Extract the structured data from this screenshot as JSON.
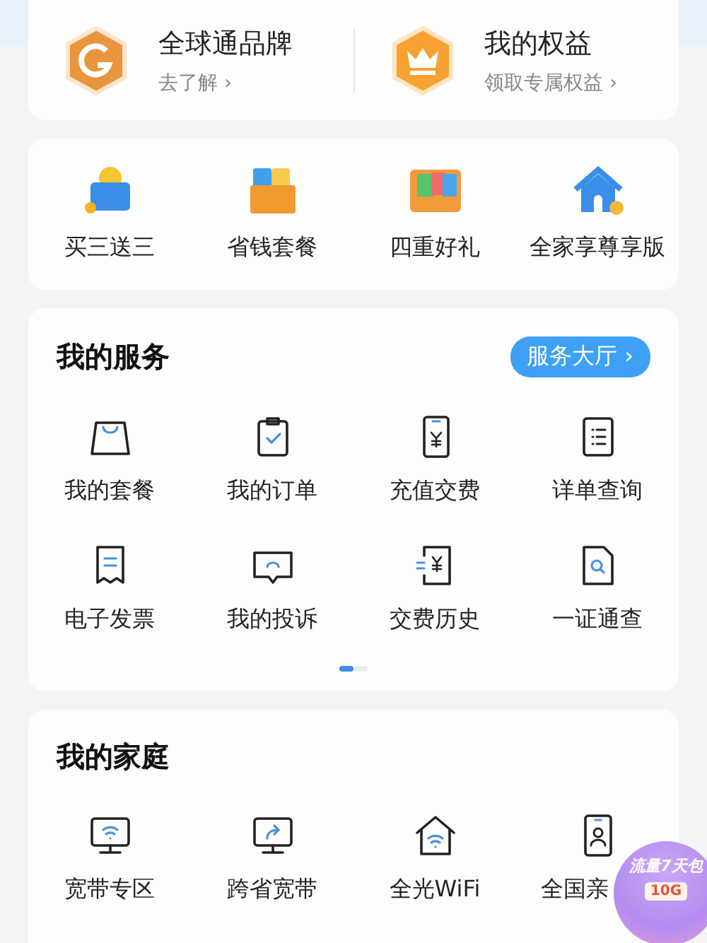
{
  "benefits": [
    {
      "title": "全球通品牌",
      "subtitle": "去了解",
      "arrow": "›"
    },
    {
      "title": "我的权益",
      "subtitle": "领取专属权益",
      "arrow": "›"
    }
  ],
  "promos": [
    {
      "label": "买三送三"
    },
    {
      "label": "省钱套餐"
    },
    {
      "label": "四重好礼"
    },
    {
      "label": "全家享尊享版"
    }
  ],
  "services": {
    "title": "我的服务",
    "hall_button": "服务大厅 ›",
    "items": [
      {
        "label": "我的套餐"
      },
      {
        "label": "我的订单"
      },
      {
        "label": "充值交费"
      },
      {
        "label": "详单查询"
      },
      {
        "label": "电子发票"
      },
      {
        "label": "我的投诉"
      },
      {
        "label": "交费历史"
      },
      {
        "label": "一证通查"
      }
    ],
    "pages": [
      {
        "selected": true
      },
      {
        "selected": false
      }
    ]
  },
  "family": {
    "title": "我的家庭",
    "items": [
      {
        "label": "宽带专区"
      },
      {
        "label": "跨省宽带"
      },
      {
        "label": "全光WiFi"
      },
      {
        "label": "全国亲"
      }
    ]
  },
  "floating_badge": {
    "title": "流量7天包",
    "amount": "10G"
  }
}
